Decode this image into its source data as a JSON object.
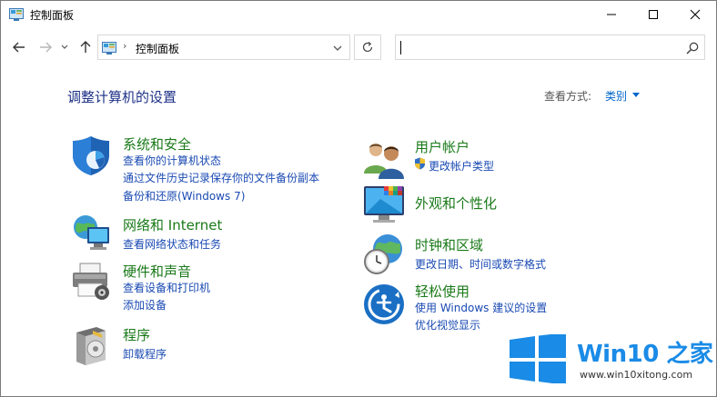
{
  "window": {
    "title": "控制面板"
  },
  "nav": {
    "address": "控制面板",
    "search_placeholder": ""
  },
  "content": {
    "heading": "调整计算机的设置",
    "view_by_label": "查看方式:",
    "view_by_value": "类别"
  },
  "categories": {
    "system": {
      "title": "系统和安全",
      "links": [
        "查看你的计算机状态",
        "通过文件历史记录保存你的文件备份副本",
        "备份和还原(Windows 7)"
      ]
    },
    "network": {
      "title": "网络和 Internet",
      "links": [
        "查看网络状态和任务"
      ]
    },
    "hardware": {
      "title": "硬件和声音",
      "links": [
        "查看设备和打印机",
        "添加设备"
      ]
    },
    "programs": {
      "title": "程序",
      "links": [
        "卸载程序"
      ]
    },
    "accounts": {
      "title": "用户帐户",
      "links": [
        "更改帐户类型"
      ]
    },
    "appearance": {
      "title": "外观和个性化",
      "links": []
    },
    "clock": {
      "title": "时钟和区域",
      "links": [
        "更改日期、时间或数字格式"
      ]
    },
    "ease": {
      "title": "轻松使用",
      "links": [
        "使用 Windows 建议的设置",
        "优化视觉显示"
      ]
    }
  },
  "watermark": {
    "brand": "Win10 之家",
    "url": "www.win10xitong.com"
  },
  "colors": {
    "heading": "#1e3287",
    "category_title": "#1a7a1a",
    "link": "#1a4ab3",
    "accent": "#0078d7"
  }
}
